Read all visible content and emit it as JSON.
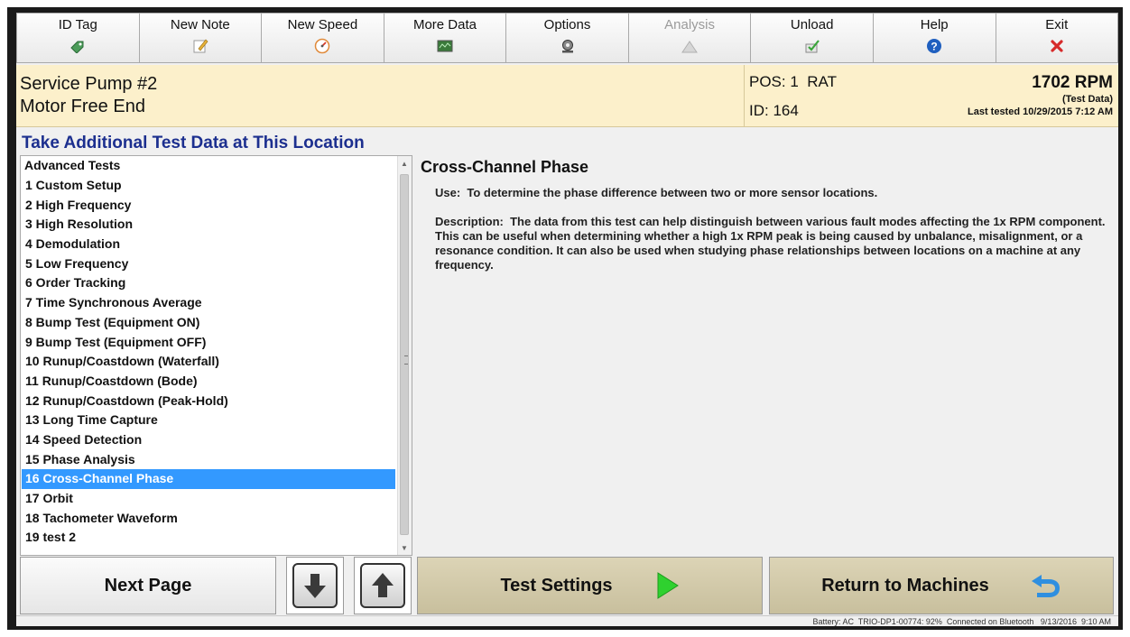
{
  "toolbar": {
    "buttons": [
      {
        "label": "ID Tag",
        "icon": "tag-icon"
      },
      {
        "label": "New Note",
        "icon": "note-icon"
      },
      {
        "label": "New Speed",
        "icon": "speed-gauge-icon"
      },
      {
        "label": "More Data",
        "icon": "data-screen-icon"
      },
      {
        "label": "Options",
        "icon": "options-gear-icon"
      },
      {
        "label": "Analysis",
        "icon": "analysis-icon",
        "disabled": true
      },
      {
        "label": "Unload",
        "icon": "unload-icon"
      },
      {
        "label": "Help",
        "icon": "help-icon"
      },
      {
        "label": "Exit",
        "icon": "exit-x-icon"
      }
    ]
  },
  "header": {
    "machine_name": "Service Pump #2",
    "location": "Motor Free End",
    "position": "POS: 1  RAT",
    "id": "ID: 164",
    "rpm": "1702 RPM",
    "test_data": "(Test Data)",
    "last_tested": "Last tested 10/29/2015 7:12 AM"
  },
  "section_title": "Take Additional Test Data at This Location",
  "list": {
    "header": "Advanced Tests",
    "items": [
      "1  Custom Setup",
      "2  High Frequency",
      "3  High Resolution",
      "4  Demodulation",
      "5  Low Frequency",
      "6  Order Tracking",
      "7  Time Synchronous Average",
      "8  Bump Test (Equipment ON)",
      "9  Bump Test (Equipment OFF)",
      "10  Runup/Coastdown (Waterfall)",
      "11  Runup/Coastdown (Bode)",
      "12  Runup/Coastdown (Peak-Hold)",
      "13  Long Time Capture",
      "14  Speed Detection",
      "15  Phase Analysis",
      "16  Cross-Channel Phase",
      "17  Orbit",
      "18  Tachometer Waveform",
      "19  test 2"
    ],
    "selected_index": 15
  },
  "detail": {
    "title": "Cross-Channel Phase",
    "use": "Use:  To determine the phase difference between two or more sensor locations.",
    "description": "Description:  The data from this test can help distinguish between various fault modes affecting the 1x RPM component.  This can be useful when determining whether a high 1x RPM peak is being caused by unbalance, misalignment, or a resonance condition. It can also be used when studying phase relationships between locations on a machine at any frequency."
  },
  "buttons": {
    "next_page": "Next Page",
    "down_arrow_icon": "down-arrow-icon",
    "up_arrow_icon": "up-arrow-icon",
    "test_settings": "Test Settings",
    "return": "Return to Machines"
  },
  "status_bar": "Battery: AC  TRIO-DP1-00774: 92%  Connected on Bluetooth   9/13/2016  9:10 AM",
  "colors": {
    "header_bg": "#fcf0cb",
    "section_title": "#1c2f8f",
    "selection": "#3399ff",
    "tan_button": "#d6cdaf",
    "play_green": "#2fd12f",
    "return_blue": "#2f8fe0"
  }
}
